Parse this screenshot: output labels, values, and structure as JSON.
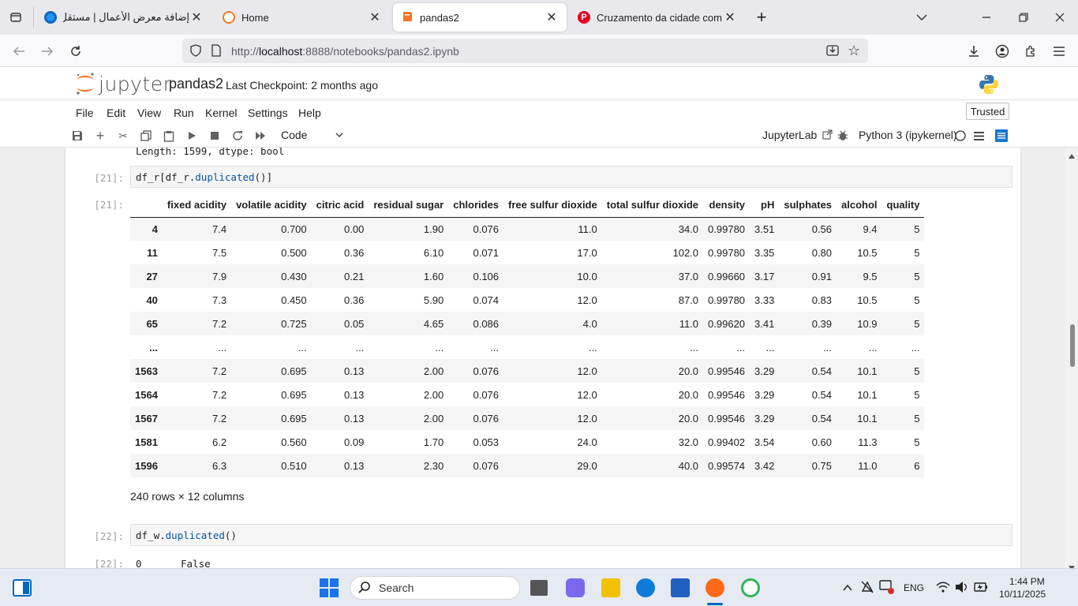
{
  "browser": {
    "tabs": [
      {
        "title": "إضافة معرض الأعمال | مستقل",
        "icon": "mostaql-favicon",
        "active": false
      },
      {
        "title": "Home",
        "icon": "jupyter-favicon",
        "active": false
      },
      {
        "title": "pandas2",
        "icon": "notebook-favicon",
        "active": true
      },
      {
        "title": "Cruzamento da cidade com sen",
        "icon": "pinterest-favicon",
        "active": false
      }
    ],
    "url_prefix": "http://",
    "url_host": "localhost",
    "url_rest": ":8888/notebooks/pandas2.ipynb"
  },
  "jupyter": {
    "logo_text": "jupyter",
    "notebook_title": "pandas2",
    "checkpoint": "Last Checkpoint: 2 months ago",
    "menu": [
      "File",
      "Edit",
      "View",
      "Run",
      "Kernel",
      "Settings",
      "Help"
    ],
    "trusted": "Trusted",
    "cell_type": "Code",
    "jupyterlab_link": "JupyterLab",
    "kernel": "Python 3 (ipykernel)"
  },
  "cells": {
    "prev_output": "Length: 1599, dtype: bool",
    "cell21": {
      "in_prompt": "[21]:",
      "code_a": "df_r[df_r.",
      "code_call": "duplicated",
      "code_b": "()]",
      "out_prompt": "[21]:"
    },
    "dataframe": {
      "columns": [
        "",
        "fixed acidity",
        "volatile acidity",
        "citric acid",
        "residual sugar",
        "chlorides",
        "free sulfur dioxide",
        "total sulfur dioxide",
        "density",
        "pH",
        "sulphates",
        "alcohol",
        "quality"
      ],
      "rows": [
        [
          "4",
          "7.4",
          "0.700",
          "0.00",
          "1.90",
          "0.076",
          "11.0",
          "34.0",
          "0.99780",
          "3.51",
          "0.56",
          "9.4",
          "5"
        ],
        [
          "11",
          "7.5",
          "0.500",
          "0.36",
          "6.10",
          "0.071",
          "17.0",
          "102.0",
          "0.99780",
          "3.35",
          "0.80",
          "10.5",
          "5"
        ],
        [
          "27",
          "7.9",
          "0.430",
          "0.21",
          "1.60",
          "0.106",
          "10.0",
          "37.0",
          "0.99660",
          "3.17",
          "0.91",
          "9.5",
          "5"
        ],
        [
          "40",
          "7.3",
          "0.450",
          "0.36",
          "5.90",
          "0.074",
          "12.0",
          "87.0",
          "0.99780",
          "3.33",
          "0.83",
          "10.5",
          "5"
        ],
        [
          "65",
          "7.2",
          "0.725",
          "0.05",
          "4.65",
          "0.086",
          "4.0",
          "11.0",
          "0.99620",
          "3.41",
          "0.39",
          "10.9",
          "5"
        ],
        [
          "...",
          "...",
          "...",
          "...",
          "...",
          "...",
          "...",
          "...",
          "...",
          "...",
          "...",
          "...",
          "..."
        ],
        [
          "1563",
          "7.2",
          "0.695",
          "0.13",
          "2.00",
          "0.076",
          "12.0",
          "20.0",
          "0.99546",
          "3.29",
          "0.54",
          "10.1",
          "5"
        ],
        [
          "1564",
          "7.2",
          "0.695",
          "0.13",
          "2.00",
          "0.076",
          "12.0",
          "20.0",
          "0.99546",
          "3.29",
          "0.54",
          "10.1",
          "5"
        ],
        [
          "1567",
          "7.2",
          "0.695",
          "0.13",
          "2.00",
          "0.076",
          "12.0",
          "20.0",
          "0.99546",
          "3.29",
          "0.54",
          "10.1",
          "5"
        ],
        [
          "1581",
          "6.2",
          "0.560",
          "0.09",
          "1.70",
          "0.053",
          "24.0",
          "32.0",
          "0.99402",
          "3.54",
          "0.60",
          "11.3",
          "5"
        ],
        [
          "1596",
          "6.3",
          "0.510",
          "0.13",
          "2.30",
          "0.076",
          "29.0",
          "40.0",
          "0.99574",
          "3.42",
          "0.75",
          "11.0",
          "6"
        ]
      ],
      "shape": "240 rows × 12 columns"
    },
    "cell22": {
      "in_prompt": "[22]:",
      "code_a": "df_w.",
      "code_call": "duplicated",
      "code_b": "()",
      "out_prompt": "[22]:",
      "out_index": "0",
      "out_value": "False"
    }
  },
  "taskbar": {
    "search": "Search",
    "lang": "ENG",
    "time": "1:44 PM",
    "date": "10/11/2025"
  },
  "colors": {
    "jupyter_orange": "#f37726",
    "accent_blue": "#1976d2",
    "code_blue": "#0055aa"
  }
}
